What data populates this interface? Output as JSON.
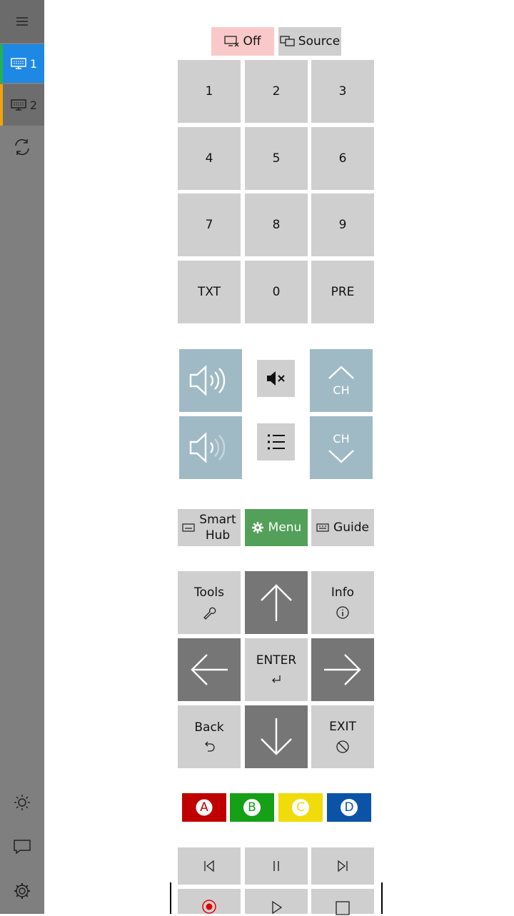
{
  "sidebar": {
    "devices": [
      {
        "number": "1"
      },
      {
        "number": "2"
      }
    ]
  },
  "top": {
    "off_label": "Off",
    "source_label": "Source"
  },
  "numpad": {
    "keys": [
      "1",
      "2",
      "3",
      "4",
      "5",
      "6",
      "7",
      "8",
      "9",
      "TXT",
      "0",
      "PRE"
    ]
  },
  "volume": {
    "ch_up_label": "CH",
    "ch_down_label": "CH"
  },
  "menu_row": {
    "smart_hub_line1": "Smart",
    "smart_hub_line2": "Hub",
    "menu_label": "Menu",
    "guide_label": "Guide"
  },
  "nav": {
    "tools_label": "Tools",
    "info_label": "Info",
    "enter_label": "ENTER",
    "back_label": "Back",
    "exit_label": "EXIT"
  },
  "color_buttons": [
    {
      "letter": "A",
      "color": "#c00000"
    },
    {
      "letter": "B",
      "color": "#16a016"
    },
    {
      "letter": "C",
      "color": "#f0dc0a"
    },
    {
      "letter": "D",
      "color": "#0b53a6"
    }
  ],
  "colors": {
    "sidebar": "#7f7f7f",
    "active_device": "#1e88e5",
    "key": "#cfcfcf",
    "nav_dark": "#767676",
    "volume": "#9fbac4",
    "menu": "#52a05a",
    "off": "#f9c9c9"
  }
}
